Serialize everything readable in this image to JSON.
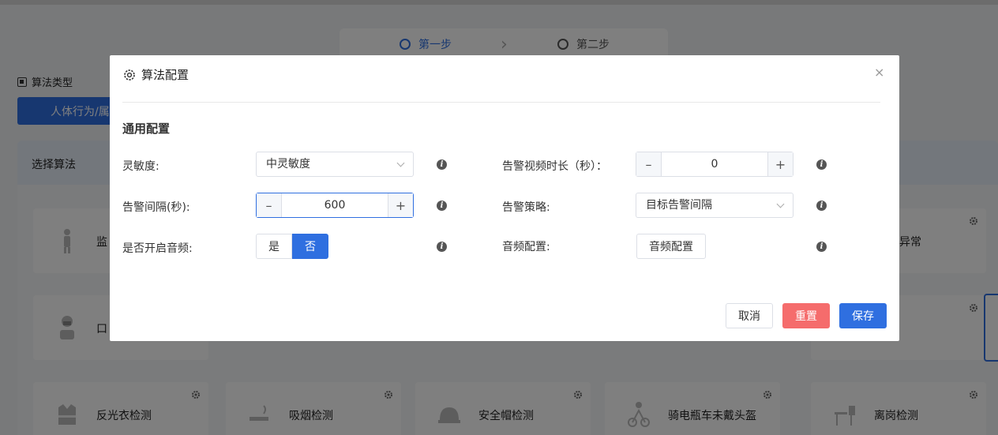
{
  "steps": {
    "step1": "第一步",
    "step2": "第二步"
  },
  "algorithm_type": {
    "title": "算法类型",
    "selected_button": "人体行为/属"
  },
  "select_algorithm": {
    "title": "选择算法",
    "cards_row1": [
      {
        "name": "监",
        "icon": "person-detect-icon"
      },
      {
        "name": "异常",
        "icon": ""
      }
    ],
    "cards_row2": [
      {
        "name": "口",
        "icon": "mask-person-icon"
      }
    ],
    "cards_row3": [
      {
        "name": "反光衣检测",
        "icon": "reflective-vest-icon"
      },
      {
        "name": "吸烟检测",
        "icon": "smoking-icon"
      },
      {
        "name": "安全帽检测",
        "icon": "helmet-icon"
      },
      {
        "name": "骑电瓶车未戴头盔",
        "icon": "e-bike-rider-icon"
      },
      {
        "name": "离岗检测",
        "icon": "empty-desk-icon"
      }
    ]
  },
  "modal": {
    "title": "算法配置",
    "section": "通用配置",
    "fields": {
      "sensitivity_label": "灵敏度:",
      "sensitivity_value": "中灵敏度",
      "alarm_interval_label": "告警间隔(秒):",
      "alarm_interval_value": "600",
      "audio_enable_label": "是否开启音频:",
      "audio_yes": "是",
      "audio_no": "否",
      "video_duration_label": "告警视频时长（秒）：",
      "video_duration_value": "0",
      "alarm_strategy_label": "告警策略:",
      "alarm_strategy_value": "目标告警间隔",
      "audio_config_label": "音频配置:",
      "audio_config_button": "音频配置"
    },
    "buttons": {
      "cancel": "取消",
      "reset": "重置",
      "save": "保存"
    },
    "close_symbol": "×",
    "minus_symbol": "–",
    "plus_symbol": "+",
    "info_symbol": "i"
  },
  "colors": {
    "primary": "#2f6fe0",
    "danger": "#f56c6c",
    "overlay": "rgba(0,0,0,0.5)"
  }
}
